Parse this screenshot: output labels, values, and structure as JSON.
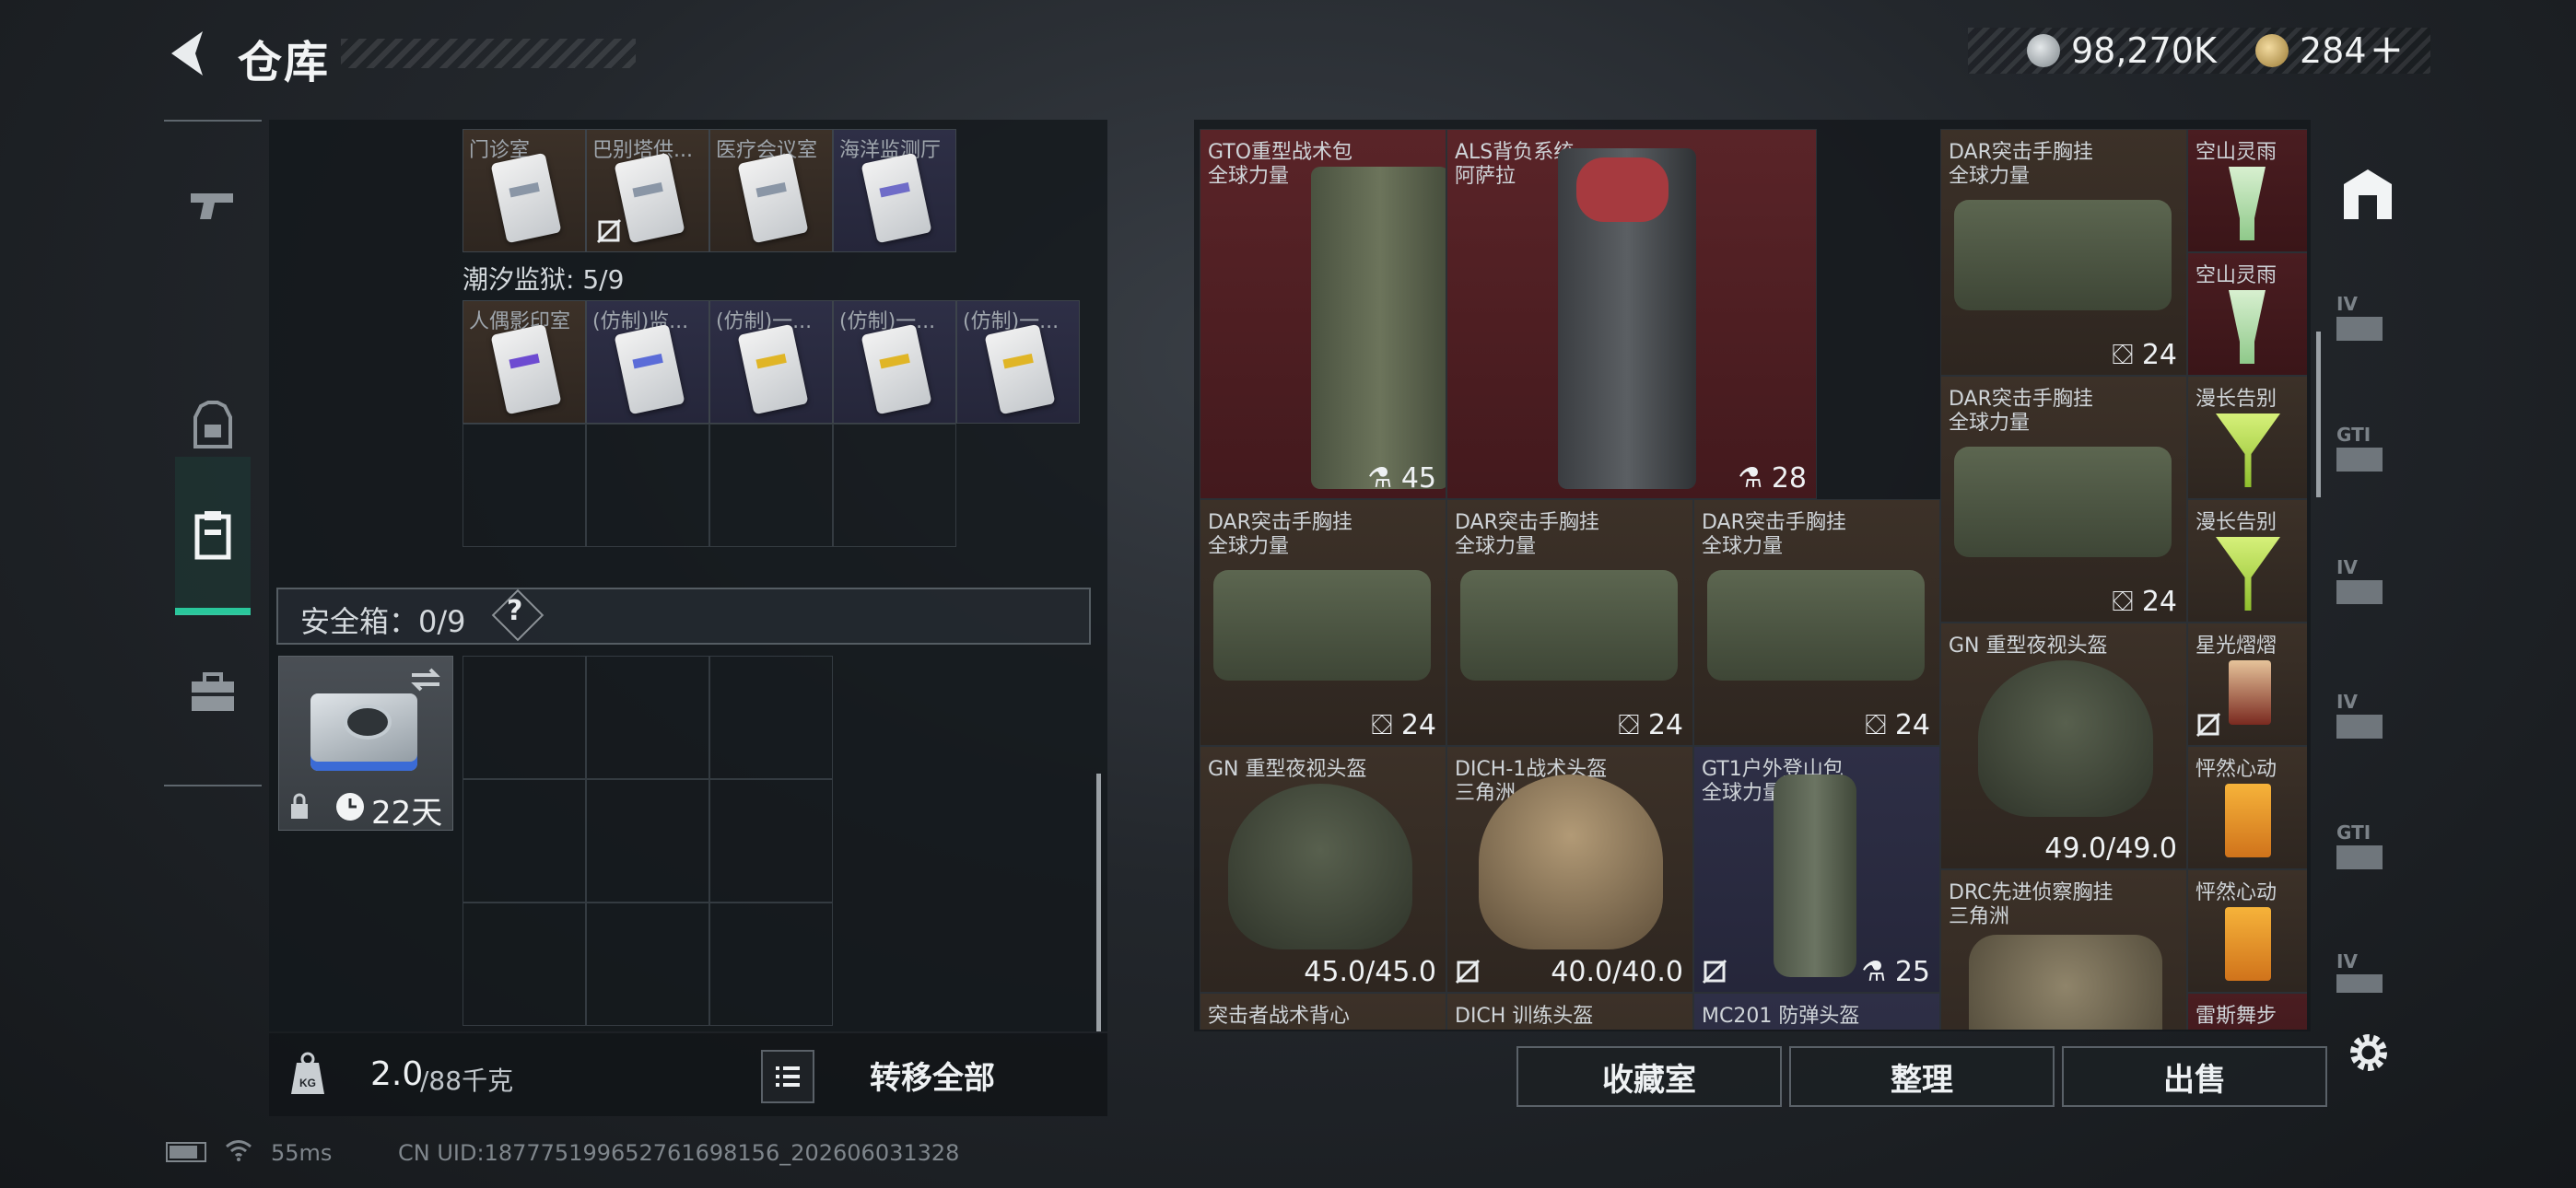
{
  "header": {
    "title": "仓库",
    "silver_amount": "98,270K",
    "gold_amount": "284",
    "gold_plus": "+"
  },
  "left_panel": {
    "row1_cells": [
      {
        "label": "门诊室",
        "frame": "brown",
        "disabled": false
      },
      {
        "label": "巴别塔供...",
        "frame": "brown",
        "disabled": true
      },
      {
        "label": "医疗会议室",
        "frame": "brown",
        "disabled": false
      },
      {
        "label": "海洋监测厅",
        "frame": "violet",
        "disabled": false
      }
    ],
    "section_title": "潮汐监狱: 5/9",
    "row2_cells": [
      {
        "label": "人偶影印室",
        "frame": "brown",
        "stripe": "#6d4bd1"
      },
      {
        "label": "(仿制)监...",
        "frame": "violet",
        "stripe": "#5b6cd8"
      },
      {
        "label": "(仿制)一...",
        "frame": "violet",
        "stripe": "#e0b526"
      },
      {
        "label": "(仿制)一...",
        "frame": "violet",
        "stripe": "#e0b526"
      },
      {
        "label": "(仿制)一...",
        "frame": "violet",
        "stripe": "#e0b526"
      }
    ],
    "safe_box": {
      "label": "安全箱：0/9",
      "help": "?",
      "days": "22天"
    },
    "weight": {
      "current": "2.0",
      "max": "/88千克"
    },
    "transfer_all": "转移全部"
  },
  "right_panel": {
    "items": [
      {
        "n1": "GTO重型战术包",
        "n2": "全球力量",
        "count": "45",
        "bg": "red"
      },
      {
        "n1": "ALS背负系统",
        "n2": "阿萨拉",
        "count": "28",
        "bg": "red"
      },
      {
        "n1": "DAR突击手胸挂",
        "n2": "全球力量",
        "count": "24",
        "bg": "brown"
      },
      {
        "n1": "空山灵雨",
        "n2": "",
        "count": "",
        "bg": "dred"
      },
      {
        "n1": "空山灵雨",
        "n2": "",
        "count": "",
        "bg": "dred"
      },
      {
        "n1": "DAR突击手胸挂",
        "n2": "全球力量",
        "count": "24",
        "bg": "brown"
      },
      {
        "n1": "漫长告别",
        "n2": "",
        "count": "",
        "bg": "brown"
      },
      {
        "n1": "漫长告别",
        "n2": "",
        "count": "",
        "bg": "brown"
      },
      {
        "n1": "DAR突击手胸挂",
        "n2": "全球力量",
        "count": "24",
        "bg": "brown"
      },
      {
        "n1": "DAR突击手胸挂",
        "n2": "全球力量",
        "count": "24",
        "bg": "brown"
      },
      {
        "n1": "DAR突击手胸挂",
        "n2": "全球力量",
        "count": "24",
        "bg": "brown"
      },
      {
        "n1": "GN 重型夜视头盔",
        "n2": "",
        "count": "49.0/49.0",
        "bg": "brown"
      },
      {
        "n1": "星光熠熠",
        "n2": "",
        "count": "",
        "bg": "brown"
      },
      {
        "n1": "GN 重型夜视头盔",
        "n2": "",
        "count": "45.0/45.0",
        "bg": "brown"
      },
      {
        "n1": "DICH-1战术头盔",
        "n2": "三角洲",
        "count": "40.0/40.0",
        "bg": "brown"
      },
      {
        "n1": "GT1户外登山包",
        "n2": "全球力量",
        "count": "25",
        "bg": "violet"
      },
      {
        "n1": "怦然心动",
        "n2": "",
        "count": "",
        "bg": "brown"
      },
      {
        "n1": "怦然心动",
        "n2": "",
        "count": "",
        "bg": "brown"
      },
      {
        "n1": "DRC先进侦察胸挂",
        "n2": "三角洲",
        "count": "",
        "bg": "brown"
      },
      {
        "n1": "突击者战术背心",
        "n2": "",
        "count": "",
        "bg": "brown"
      },
      {
        "n1": "DICH 训练头盔",
        "n2": "",
        "count": "",
        "bg": "brown"
      },
      {
        "n1": "MC201 防弹头盔",
        "n2": "",
        "count": "",
        "bg": "violet"
      },
      {
        "n1": "雷斯舞步",
        "n2": "",
        "count": "",
        "bg": "dred"
      }
    ],
    "buttons": {
      "collection": "收藏室",
      "organize": "整理",
      "sell": "出售"
    }
  },
  "right_sidebar": {
    "labels": [
      "IV",
      "GTI",
      "IV",
      "IV",
      "GTI",
      "IV"
    ]
  },
  "status_bar": {
    "ping": "55ms",
    "uid": "CN UID:187775199652761698156_202606031328"
  },
  "colors": {
    "accent": "#29c79b",
    "rarity_red": "#5a2428",
    "rarity_brown": "#3c3128",
    "rarity_violet": "#2e2f46"
  }
}
